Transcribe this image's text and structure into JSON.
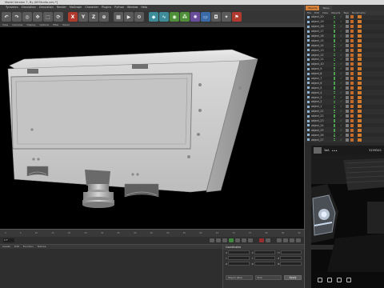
{
  "window": {
    "title": "Model Version 7, By JUEStudio.vdu *]"
  },
  "menu": [
    "",
    "Tynamics",
    "Simulation",
    "Simulation",
    "Render",
    "MoGraph",
    "Character",
    "Plugins",
    "Python",
    "Window",
    "Help"
  ],
  "toolbar": {
    "buttons": [
      {
        "icon": "undo-icon",
        "glyph": "↶",
        "color": "gray"
      },
      {
        "icon": "redo-icon",
        "glyph": "↷",
        "color": "gray"
      },
      {
        "icon": "live-selection-icon",
        "glyph": "◎",
        "color": "gray"
      },
      {
        "icon": "move-icon",
        "glyph": "✥",
        "color": "gray"
      },
      {
        "icon": "scale-icon",
        "glyph": "⬚",
        "color": "gray"
      },
      {
        "icon": "rotate-icon",
        "glyph": "⟳",
        "color": "gray"
      },
      {
        "icon": "x-axis-icon",
        "glyph": "X",
        "color": "red"
      },
      {
        "icon": "y-axis-icon",
        "glyph": "Y",
        "color": "gray"
      },
      {
        "icon": "z-axis-icon",
        "glyph": "Z",
        "color": "gray"
      },
      {
        "icon": "coordinate-system-icon",
        "glyph": "⊕",
        "color": "gray"
      },
      {
        "icon": "render-view-icon",
        "glyph": "▦",
        "color": "gray"
      },
      {
        "icon": "render-picture-viewer-icon",
        "glyph": "▶",
        "color": "gray"
      },
      {
        "icon": "render-settings-icon",
        "glyph": "⚙",
        "color": "gray"
      },
      {
        "icon": "cube-icon",
        "glyph": "◆",
        "color": "teal"
      },
      {
        "icon": "spline-icon",
        "glyph": "∿",
        "color": "teal"
      },
      {
        "icon": "nurbs-icon",
        "glyph": "◉",
        "color": "green"
      },
      {
        "icon": "array-icon",
        "glyph": "⁂",
        "color": "green"
      },
      {
        "icon": "deformer-icon",
        "glyph": "✺",
        "color": "purple"
      },
      {
        "icon": "floor-icon",
        "glyph": "▭",
        "color": "blue"
      },
      {
        "icon": "camera-icon",
        "glyph": "◘",
        "color": "gray"
      },
      {
        "icon": "light-icon",
        "glyph": "✦",
        "color": "gray"
      },
      {
        "icon": "tag-icon",
        "glyph": "⚑",
        "color": "red"
      }
    ]
  },
  "viewport": {
    "menu": [
      "View",
      "Cameras",
      "Display",
      "Options",
      "Filter",
      "Panel"
    ]
  },
  "timeline": {
    "ticks": [
      "0",
      "5",
      "10",
      "15",
      "20",
      "25",
      "30",
      "35",
      "40",
      "45",
      "50",
      "55",
      "60",
      "65",
      "70",
      "75",
      "80",
      "85",
      "90"
    ],
    "current_frame": "0 F"
  },
  "materials": {
    "menu": [
      "Create",
      "Edit",
      "Function",
      "Texture"
    ]
  },
  "coordinates": {
    "title": "Coordinates",
    "rows": [
      [
        {
          "axis": "X",
          "value": ""
        },
        {
          "axis": "X",
          "value": ""
        },
        {
          "axis": "H",
          "value": ""
        }
      ],
      [
        {
          "axis": "Y",
          "value": ""
        },
        {
          "axis": "Y",
          "value": ""
        },
        {
          "axis": "P",
          "value": ""
        }
      ],
      [
        {
          "axis": "Z",
          "value": ""
        },
        {
          "axis": "Z",
          "value": ""
        },
        {
          "axis": "B",
          "value": ""
        }
      ]
    ],
    "mode_dropdown": "Object (Rel)",
    "size_dropdown": "Size",
    "apply_label": "Apply"
  },
  "object_manager": {
    "tabs": [
      "Objects",
      "Takes"
    ],
    "menu": [
      "File",
      "Edit",
      "View",
      "Objects",
      "Tags",
      "Bookmarks"
    ],
    "rows": [
      "object_20",
      "object_19",
      "object_18",
      "object_17",
      "object_16",
      "object_15",
      "object_14",
      "object_13",
      "object_12",
      "object_11",
      "object_10",
      "object_9",
      "object_8",
      "object_7",
      "object_6",
      "object_5",
      "object_4",
      "object_3",
      "object_2",
      "object_1",
      "object_21",
      "object_22",
      "object_23",
      "object_24",
      "object_25",
      "object_26",
      "object_27"
    ]
  },
  "overlay": {
    "app_name": "3dA",
    "more_label": "•••",
    "count": "3195541",
    "bottom_icons": [
      "share-icon",
      "bookmark-icon",
      "info-icon",
      "delete-icon"
    ]
  },
  "colors": {
    "accent_orange": "#d6803a",
    "viewport_bg": "#000000",
    "model_surface": "#cfcfcf"
  }
}
